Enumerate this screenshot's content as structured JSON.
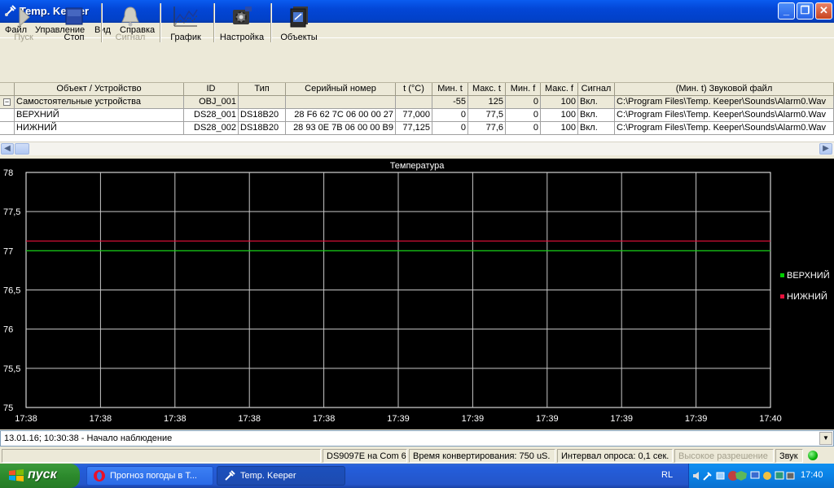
{
  "window": {
    "title": "Temp. Keeper"
  },
  "menu": [
    "Файл",
    "Управление",
    "Вид",
    "Справка"
  ],
  "toolbar": [
    {
      "label": "Пуск",
      "icon": "play-icon",
      "enabled": false
    },
    {
      "label": "Стоп",
      "icon": "stop-icon",
      "enabled": true
    },
    {
      "label": "Сигнал",
      "icon": "bell-icon",
      "enabled": false
    },
    {
      "label": "График",
      "icon": "chart-icon",
      "enabled": true
    },
    {
      "label": "Настройка",
      "icon": "settings-icon",
      "enabled": true
    },
    {
      "label": "Объекты",
      "icon": "objects-icon",
      "enabled": true
    }
  ],
  "grid": {
    "columns": [
      "Объект / Устройство",
      "ID",
      "Тип",
      "Серийный номер",
      "t (°С)",
      "Мин. t",
      "Макс. t",
      "Мин. f",
      "Макс. f",
      "Сигнал",
      "(Мин. t) Звуковой файл"
    ],
    "group": {
      "name": "Самостоятельные устройства",
      "expander": "−",
      "id": "OBJ_001",
      "min_t": "-55",
      "max_t": "125",
      "min_f": "0",
      "max_f": "100",
      "signal": "Вкл.",
      "sound": "C:\\Program Files\\Temp. Keeper\\Sounds\\Alarm0.Wav"
    },
    "rows": [
      {
        "name": "ВЕРХНИЙ",
        "id": "DS28_001",
        "type": "DS18B20",
        "serial": "28 F6 62 7C 06 00 00 27",
        "t": "77,000",
        "min_t": "0",
        "max_t": "77,5",
        "min_f": "0",
        "max_f": "100",
        "signal": "Вкл.",
        "sound": "C:\\Program Files\\Temp. Keeper\\Sounds\\Alarm0.Wav"
      },
      {
        "name": "НИЖНИЙ",
        "id": "DS28_002",
        "type": "DS18B20",
        "serial": "28 93 0E 7B 06 00 00 B9",
        "t": "77,125",
        "min_t": "0",
        "max_t": "77,6",
        "min_f": "0",
        "max_f": "100",
        "signal": "Вкл.",
        "sound": "C:\\Program Files\\Temp. Keeper\\Sounds\\Alarm0.Wav"
      }
    ]
  },
  "chart_data": {
    "type": "line",
    "title": "Температура",
    "x_tick_labels": [
      "17:38",
      "17:38",
      "17:38",
      "17:38",
      "17:38",
      "17:39",
      "17:39",
      "17:39",
      "17:39",
      "17:39",
      "17:40"
    ],
    "y_tick_labels": [
      "78",
      "77,5",
      "77",
      "76,5",
      "76",
      "75,5",
      "75"
    ],
    "ylim": [
      75,
      78
    ],
    "grid": true,
    "legend_position": "right",
    "series": [
      {
        "name": "ВЕРХНИЙ",
        "color": "#00cc00",
        "values": [
          77.0,
          77.0
        ]
      },
      {
        "name": "НИЖНИЙ",
        "color": "#e8103c",
        "values": [
          77.125,
          77.125
        ]
      }
    ]
  },
  "log": {
    "text": "13.01.16; 10:30:38 - Начало наблюдение"
  },
  "status": {
    "port": "DS9097E на Com 6",
    "conversion": "Время конвертирования: 750 uS.",
    "interval": "Интервал опроса: 0,1 сек.",
    "resolution": "Высокое разрешение",
    "sound": "Звук"
  },
  "taskbar": {
    "start": "пуск",
    "tasks": [
      "Прогноз погоды в Т...",
      "Temp. Keeper"
    ],
    "lang": "RL",
    "clock": "17:40"
  }
}
